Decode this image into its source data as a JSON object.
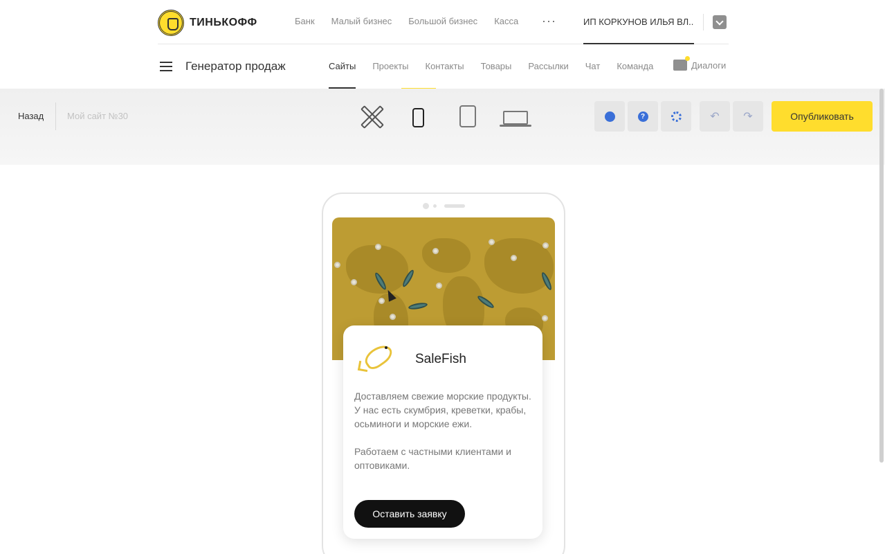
{
  "brand": {
    "logo_text": "ТИНЬКОФФ"
  },
  "topnav": {
    "items": [
      "Банк",
      "Малый бизнес",
      "Большой бизнес",
      "Касса"
    ],
    "more": "···",
    "account": "ИП КОРКУНОВ ИЛЬЯ ВЛ..."
  },
  "subnav": {
    "title": "Генератор продаж",
    "tabs": [
      "Сайты",
      "Проекты",
      "Контакты",
      "Товары",
      "Рассылки",
      "Чат",
      "Команда"
    ],
    "active_tab": "Сайты",
    "dialogs": "Диалоги"
  },
  "toolbar": {
    "back": "Назад",
    "site_name": "Мой сайт №30",
    "devices": [
      "tools-icon",
      "phone-icon",
      "tablet-icon",
      "laptop-icon"
    ],
    "active_device": "phone-icon",
    "help_glyph": "?",
    "undo_glyph": "↶",
    "redo_glyph": "↷",
    "publish": "Опубликовать",
    "accent_color": "#ffdd2d"
  },
  "preview": {
    "brand_name": "SaleFish",
    "description": "Доставляем свежие морские продукты. У нас есть скумбрия, креветки, крабы, осьминоги и морские ежи.",
    "description_2": "Работаем с частными клиентами и оптовиками.",
    "cta": "Оставить заявку",
    "map_color": "#bd9c33"
  }
}
